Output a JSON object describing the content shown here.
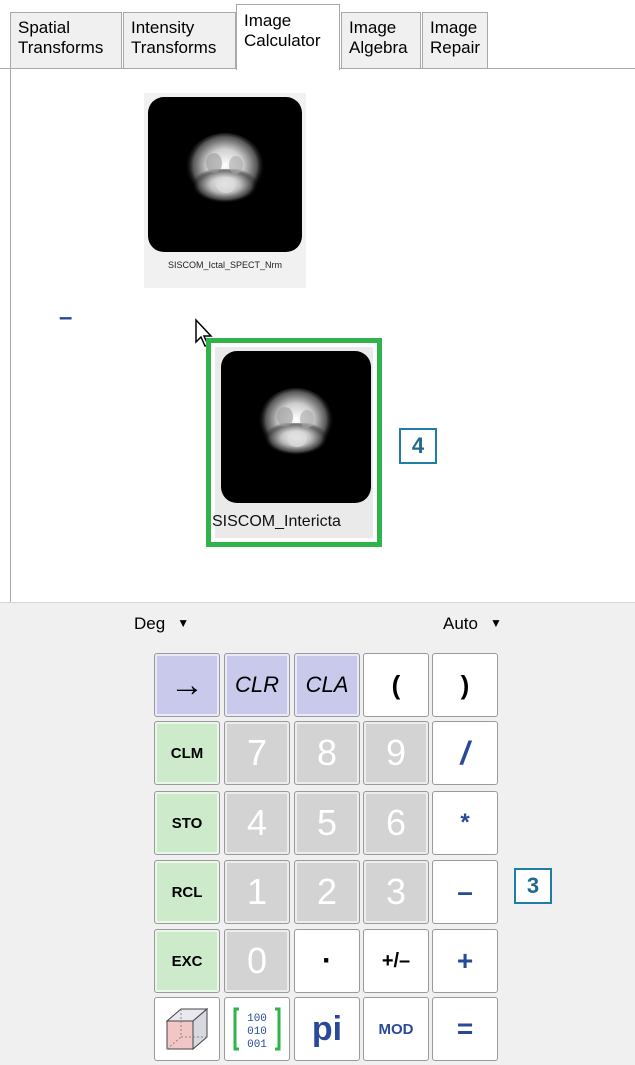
{
  "tabs": [
    {
      "label": "Spatial\nTransforms",
      "active": false
    },
    {
      "label": "Intensity\nTransforms",
      "active": false
    },
    {
      "label": "Image\nCalculator",
      "active": true
    },
    {
      "label": "Image\nAlgebra",
      "active": false
    },
    {
      "label": "Image\nRepair",
      "active": false
    }
  ],
  "workspace": {
    "image1_caption": "SISCOM_Ictal_SPECT_Nrm",
    "operator": "–",
    "image2_caption": "SISCOM_Intericta",
    "callout_image": "4",
    "callout_keypad": "3"
  },
  "modes": {
    "angle": "Deg",
    "format": "Auto"
  },
  "keypad": {
    "rows": [
      [
        "→",
        "CLR",
        "CLA",
        "(",
        ")"
      ],
      [
        "CLM",
        "7",
        "8",
        "9",
        "/"
      ],
      [
        "STO",
        "4",
        "5",
        "6",
        "*"
      ],
      [
        "RCL",
        "1",
        "2",
        "3",
        "–"
      ],
      [
        "EXC",
        "0",
        "·",
        "+/–",
        "+"
      ],
      [
        "",
        "",
        "pi",
        "MOD",
        "="
      ]
    ]
  },
  "colors": {
    "selection_border": "#2fb34a",
    "callout": "#1f7ea6",
    "operator_text": "#2a4a99",
    "memory_keys": "#cdeacb",
    "control_keys": "#c9c9ec",
    "digit_keys": "#d3d3d3"
  }
}
